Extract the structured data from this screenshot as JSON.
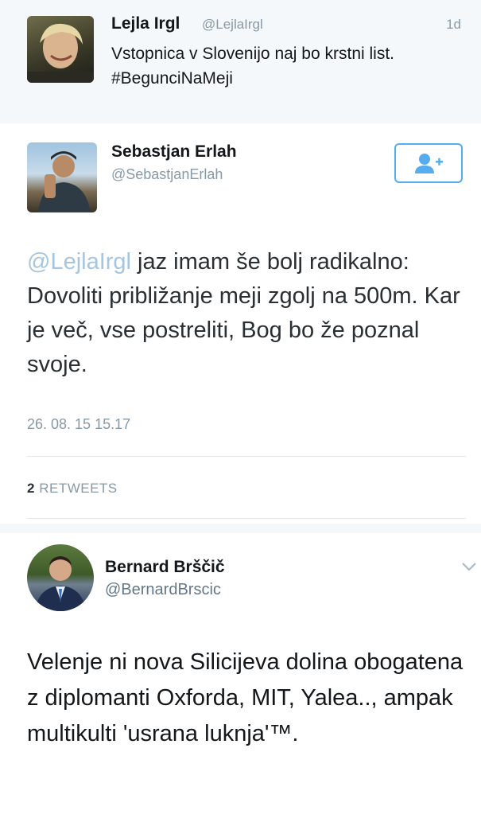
{
  "tweets": [
    {
      "name": "Lejla Irgl",
      "handle": "@LejlaIrgl",
      "time": "1d",
      "text_line1": "Vstopnica v Slovenijo naj bo krstni list.",
      "text_line2": "#BegunciNaMeji"
    },
    {
      "name": "Sebastjan Erlah",
      "handle": "@SebastjanErlah",
      "follow_icon": "add-user-icon",
      "mention": "@LejlaIrgl",
      "text": " jaz imam še bolj radikalno: Dovoliti približanje meji zgolj na 500m. Kar je več, vse postreliti, Bog bo že poznal svoje.",
      "timestamp": "26. 08. 15 15.17",
      "retweet_count": "2",
      "retweet_label": "RETWEETS"
    },
    {
      "name": "Bernard Brščič",
      "handle": "@BernardBrscic",
      "menu_icon": "chevron-down-icon",
      "text": "Velenje ni nova Silicijeva dolina obogatena z diplomanti Oxforda, MIT, Yalea.., ampak multikulti 'usrana luknja'™."
    }
  ],
  "colors": {
    "accent": "#55acee",
    "mention": "#a6c6e0",
    "muted": "#8899a6",
    "text": "#14171a"
  }
}
